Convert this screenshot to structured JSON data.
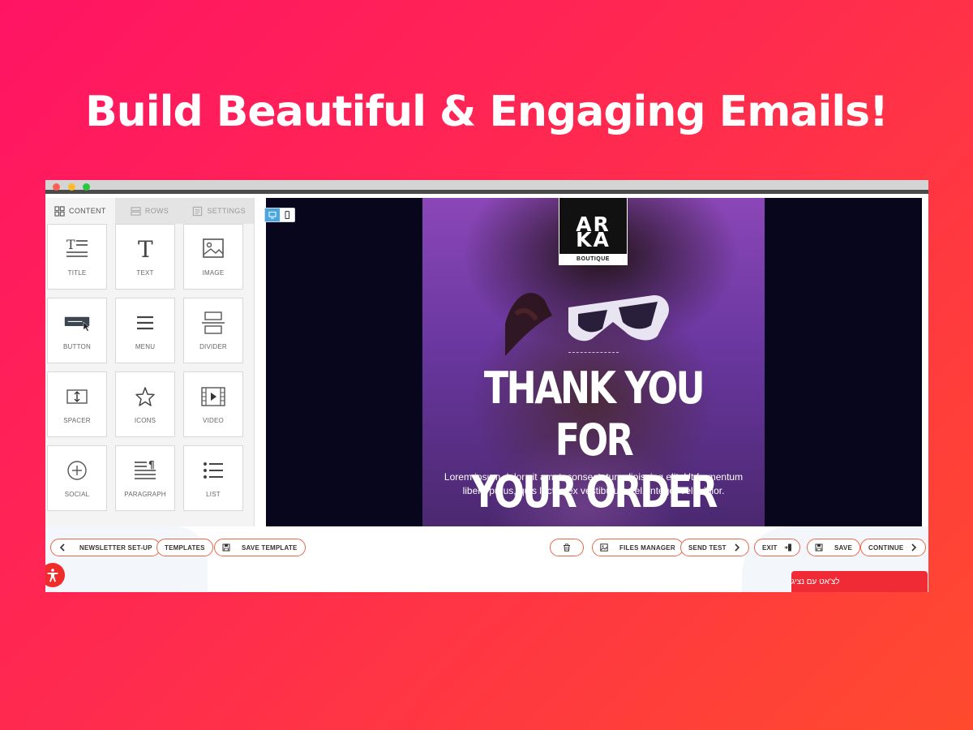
{
  "headline": "Build Beautiful & Engaging Emails!",
  "sidebar": {
    "tabs": [
      {
        "label": "CONTENT",
        "icon": "grid-icon",
        "active": true
      },
      {
        "label": "ROWS",
        "icon": "rows-icon",
        "active": false
      },
      {
        "label": "SETTINGS",
        "icon": "settings-icon",
        "active": false
      }
    ],
    "blocks": [
      {
        "label": "TITLE",
        "icon": "title-icon"
      },
      {
        "label": "TEXT",
        "icon": "text-icon"
      },
      {
        "label": "IMAGE",
        "icon": "image-icon"
      },
      {
        "label": "BUTTON",
        "icon": "button-icon"
      },
      {
        "label": "MENU",
        "icon": "menu-icon"
      },
      {
        "label": "DIVIDER",
        "icon": "divider-icon"
      },
      {
        "label": "SPACER",
        "icon": "spacer-icon"
      },
      {
        "label": "ICONS",
        "icon": "star-icon"
      },
      {
        "label": "VIDEO",
        "icon": "video-icon"
      },
      {
        "label": "SOCIAL",
        "icon": "social-icon"
      },
      {
        "label": "PARAGRAPH",
        "icon": "paragraph-icon"
      },
      {
        "label": "LIST",
        "icon": "list-icon"
      }
    ]
  },
  "email": {
    "logo_mark": "ARKA",
    "logo_sub": "BOUTIQUE",
    "title_line1": "THANK YOU FOR",
    "title_line2": "YOUR ORDER",
    "body": "Lorem ipsum dolor sit amet, consectetur adipiscing elit. Ut fermentum libero purus, quis luctus ex vestibulum vel. Integer velit dolor.",
    "colors": {
      "background": "#07061d",
      "accent": "#8b47b7"
    }
  },
  "toolbar": {
    "newsletter_setup": "NEWSLETTER SET-UP",
    "templates": "TEMPLATES",
    "save_template": "SAVE TEMPLATE",
    "files_manager": "FILES MANAGER",
    "send_test": "SEND TEST",
    "exit": "EXIT",
    "save": "SAVE",
    "continue": "CONTINUE"
  },
  "chat": {
    "label": "לצ'אט עם נציג"
  },
  "colors": {
    "brand": "#f02b36",
    "pill_border": "#e8664a"
  }
}
